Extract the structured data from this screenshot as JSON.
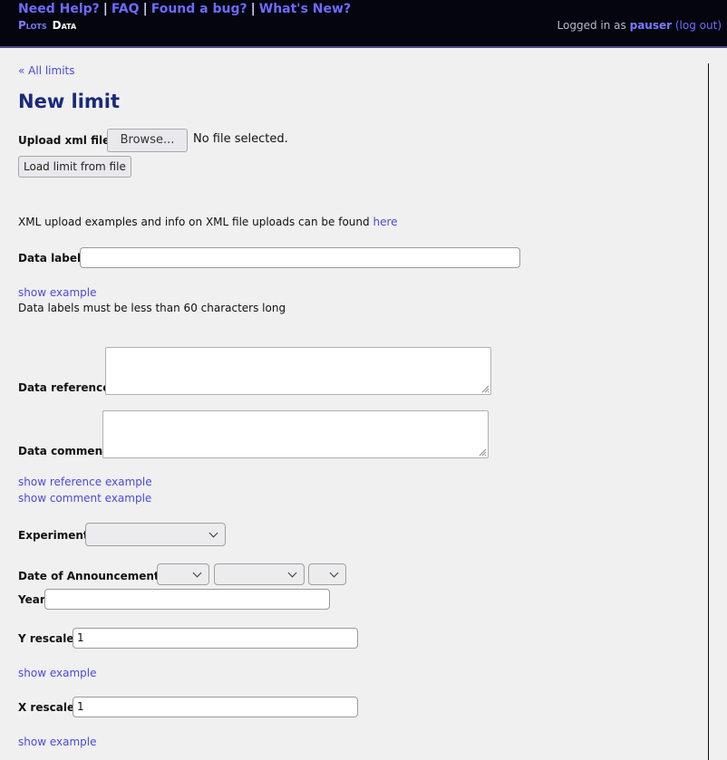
{
  "header": {
    "help_links": [
      {
        "label": "Need Help?"
      },
      {
        "label": "FAQ"
      },
      {
        "label": "Found a bug?"
      },
      {
        "label": "What's New?"
      }
    ],
    "separator": "|",
    "nav": {
      "plots": "Plots",
      "data": "Data"
    },
    "login": {
      "prefix": "Logged in as",
      "username": "pauser",
      "logout": "(log out)"
    }
  },
  "breadcrumb": "« All limits",
  "page_title": "New limit",
  "upload": {
    "label": "Upload xml file",
    "browse_button": "Browse...",
    "file_status": "No file selected.",
    "load_button": "Load limit from file"
  },
  "xml_info": {
    "text": "XML upload examples and info on XML file uploads can be found",
    "link": "here"
  },
  "data_label": {
    "label": "Data label",
    "value": "",
    "show_example": "show example",
    "note": "Data labels must be less than 60 characters long"
  },
  "data_reference": {
    "label": "Data reference"
  },
  "data_comment": {
    "label": "Data comment"
  },
  "show_reference_example": "show reference example",
  "show_comment_example": "show comment example",
  "experiment": {
    "label": "Experiment",
    "value": ""
  },
  "date_of_announcement": {
    "label": "Date of Announcement"
  },
  "year": {
    "label": "Year",
    "value": ""
  },
  "y_rescale": {
    "label": "Y rescale",
    "value": "1",
    "show_example": "show example"
  },
  "x_rescale": {
    "label": "X rescale",
    "value": "1",
    "show_example": "show example"
  },
  "colors": {
    "header_bg": "#05050f",
    "link": "#4a4adf",
    "title": "#1a2a7a",
    "page_bg": "#f0f0f0"
  }
}
